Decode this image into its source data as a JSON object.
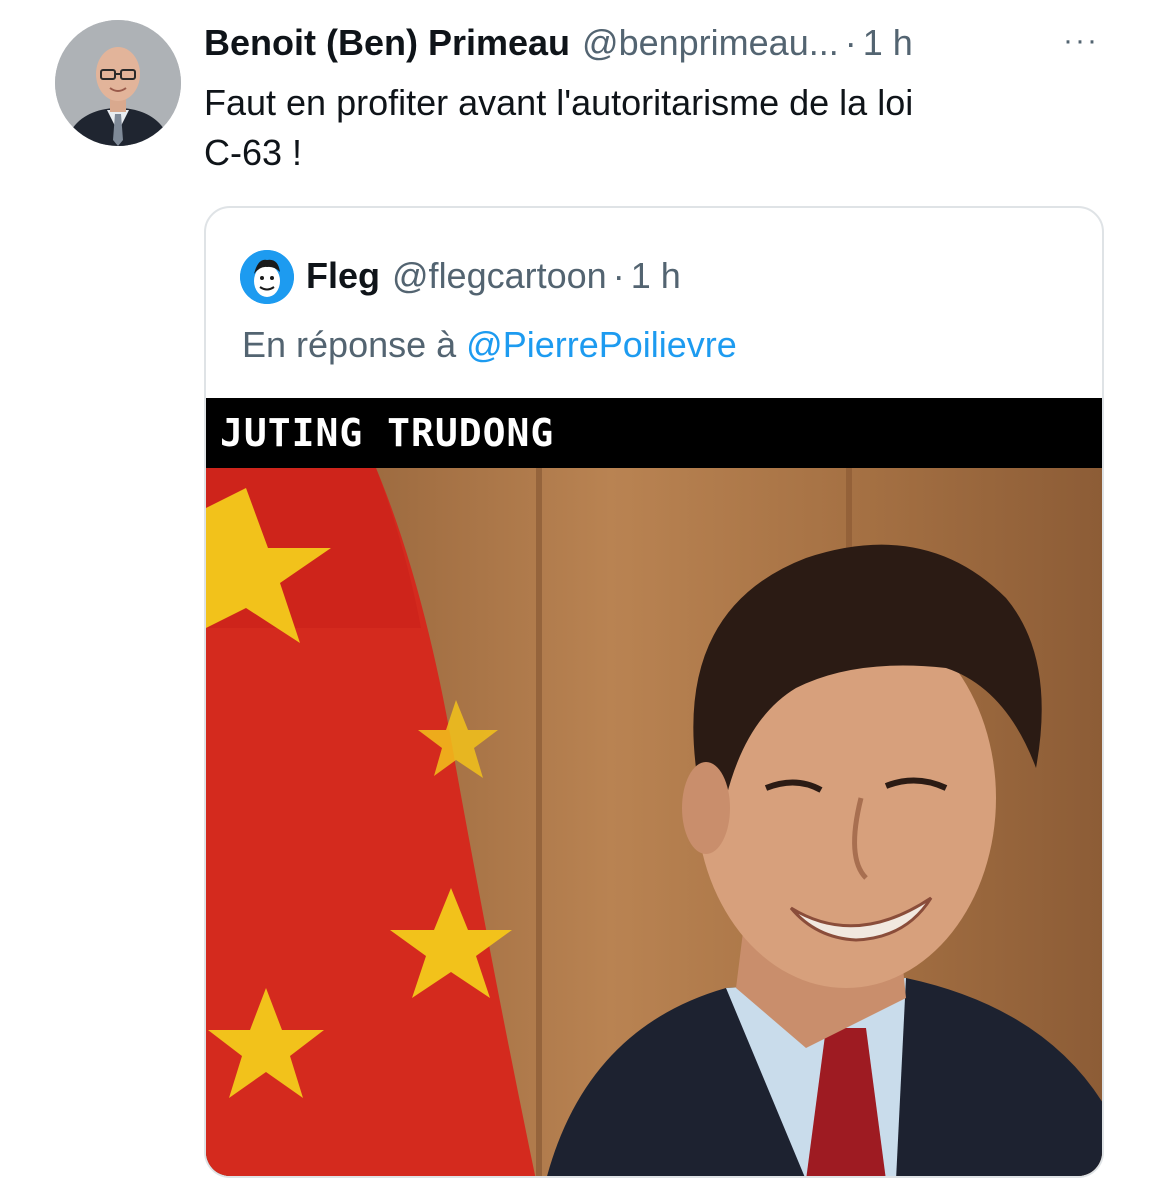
{
  "tweet": {
    "author_name": "Benoit (Ben) Primeau",
    "author_handle": "@benprimeau...",
    "separator": "·",
    "time": "1 h",
    "more_label": "···",
    "text": "Faut en profiter avant l'autoritarisme de la loi\nC-63 !"
  },
  "quoted_tweet": {
    "author_name": "Fleg",
    "author_handle": "@flegcartoon",
    "separator": "·",
    "time": "1 h",
    "reply_prefix": "En réponse à",
    "reply_to": "@PierrePoilievre",
    "media_banner": "JUTING TRUDONG"
  },
  "colors": {
    "text_primary": "#0f1419",
    "text_secondary": "#536471",
    "link": "#1d9bf0",
    "border": "#dfe3e6",
    "flag_red": "#d42a1e",
    "flag_star": "#f2c21b"
  }
}
